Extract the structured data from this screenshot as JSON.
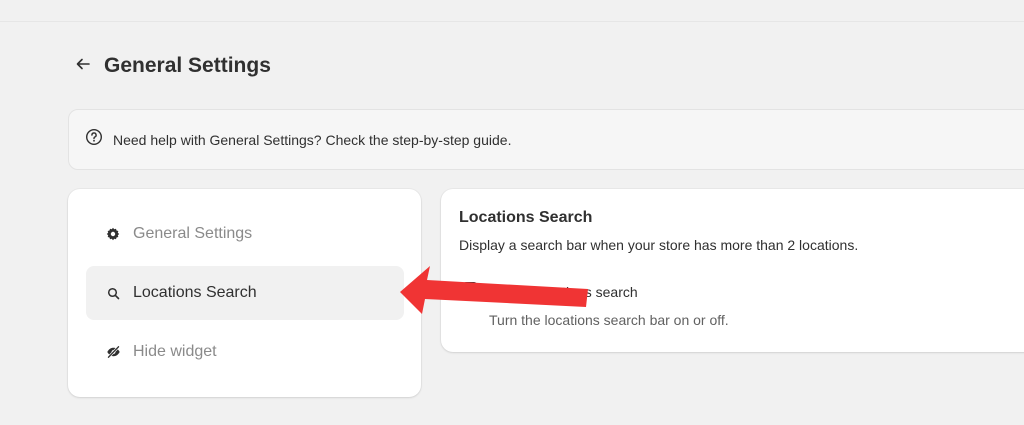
{
  "header": {
    "title": "General Settings",
    "back_icon": "arrow-left-icon"
  },
  "help_banner": {
    "icon": "question-circle-icon",
    "text": "Need help with General Settings? Check the step-by-step guide."
  },
  "sidebar": {
    "items": [
      {
        "label": "General Settings",
        "icon": "gear-icon",
        "active": false
      },
      {
        "label": "Locations Search",
        "icon": "search-icon",
        "active": true
      },
      {
        "label": "Hide widget",
        "icon": "eye-slash-icon",
        "active": false
      }
    ]
  },
  "locations_search": {
    "title": "Locations Search",
    "description": "Display a search bar when your store has more than 2 locations.",
    "checkbox_label": "Enable locations search",
    "checkbox_checked": false,
    "help_text": "Turn the locations search bar on or off."
  },
  "annotation": {
    "arrow_color": "#f03434"
  }
}
